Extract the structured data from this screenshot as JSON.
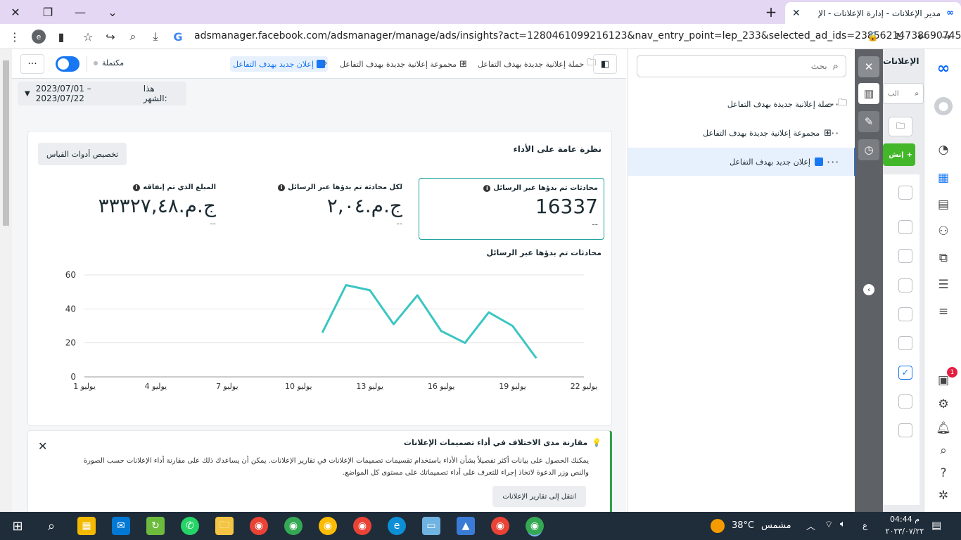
{
  "browser": {
    "tab_title": "مدير الإعلانات - إدارة الإعلانات - الإ",
    "url": "adsmanager.facebook.com/adsmanager/manage/ads/insights?act=1280461099216123&nav_entry_point=lep_233&selected_ad_ids=23856214738690745",
    "profile_letter": "e"
  },
  "toolbar": {
    "status_label": "مكتملة",
    "crumbs": [
      "حملة إعلانية جديدة بهدف التفاعل",
      "مجموعة إعلانية جديدة بهدف التفاعل",
      "إعلان جديد بهدف التفاعل"
    ]
  },
  "date_range": {
    "label": "هذا الشهر:",
    "value": "2023/07/01 – 2023/07/22"
  },
  "overview": {
    "title": "نظرة عامة على الأداء",
    "customize_button": "تخصيص أدوات القياس",
    "kpis": [
      {
        "label": "محادثات تم بدؤها عبر الرسائل",
        "value": "16337",
        "delta": "--"
      },
      {
        "label": "لكل محادثة تم بدؤها عبر الرسائل",
        "value": "ج.م.٢,٠٤",
        "delta": "--"
      },
      {
        "label": "المبلغ الذي تم إنفاقه",
        "value": "ج.م.٣٣٣٢٧,٤٨",
        "delta": "--"
      }
    ],
    "chart_title": "محادثات تم بدؤها عبر الرسائل"
  },
  "chart_data": {
    "type": "line",
    "title": "محادثات تم بدؤها عبر الرسائل",
    "xlabel": "",
    "ylabel": "",
    "x_ticks": [
      "1 يوليو",
      "4 يوليو",
      "7 يوليو",
      "10 يوليو",
      "13 يوليو",
      "16 يوليو",
      "19 يوليو",
      "22 يوليو"
    ],
    "y_ticks": [
      0,
      20,
      40,
      60
    ],
    "ylim": [
      0,
      60
    ],
    "xlim": [
      1,
      22
    ],
    "grid": true,
    "series": [
      {
        "color": "#3bc6c4",
        "x": [
          11,
          12,
          13,
          14,
          15,
          16,
          17,
          18,
          19,
          20
        ],
        "y": [
          26,
          54,
          51,
          31,
          48,
          27,
          20,
          38,
          30,
          11
        ]
      }
    ]
  },
  "notice": {
    "title": "مقارنة مدى الاختلاف في أداء تصميمات الإعلانات",
    "body": "يمكنك الحصول على بيانات أكثر تفصيلاً بشأن الأداء باستخدام تقسيمات تصميمات الإعلانات في تقارير الإعلانات. يمكن أن يساعدك ذلك على مقارنة أداء الإعلانات حسب الصورة والنص وزر الدعوة لاتخاذ إجراء للتعرف على أداء تصميماتك على مستوى كل المواضع.",
    "button": "انتقل إلى تقارير الإعلانات"
  },
  "tree": {
    "search_placeholder": "بحث",
    "items": [
      {
        "label": "حملة إعلانية جديدة بهدف التفاعل"
      },
      {
        "label": "مجموعة إعلانية جديدة بهدف التفاعل"
      },
      {
        "label": "إعلان جديد بهدف التفاعل"
      }
    ]
  },
  "right_panel": {
    "title": "الإعلانات",
    "search_fragment": "الب",
    "create_fragment": "إنش"
  },
  "nav": {
    "notification_count": "1"
  },
  "taskbar": {
    "weather_temp": "38°C",
    "weather_text": "مشمس",
    "lang": "ع",
    "time": "04:44 م",
    "date": "٢٠٢٣/٠٧/٢٢"
  },
  "colors": {
    "accent": "#1877f2",
    "chart_line": "#3bc6c4",
    "success": "#31a24c",
    "tab_bg": "#e3d7f4"
  }
}
